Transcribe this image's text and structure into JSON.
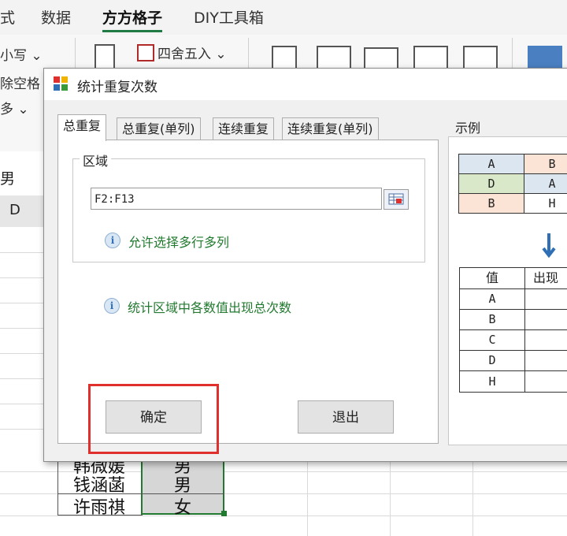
{
  "ribbon": {
    "tabs": [
      "式",
      "数据",
      "方方格子",
      "DIY工具箱"
    ],
    "active_tab": "方方格子",
    "items": {
      "lowercase": "小写 ⌄",
      "round": "四舍五入 ⌄",
      "remove_spaces": "除空格",
      "more": "多 ⌄"
    }
  },
  "sheet": {
    "cell_ref": "男",
    "column_d": "D",
    "rows": [
      {
        "name": "韩微媛",
        "gender": "男"
      },
      {
        "name": "钱涵菡",
        "gender": "男"
      },
      {
        "name": "许雨祺",
        "gender": "女"
      }
    ]
  },
  "dialog": {
    "title": "统计重复次数",
    "tabs": [
      "总重复",
      "总重复(单列)",
      "连续重复",
      "连续重复(单列)"
    ],
    "active_tab": "总重复",
    "group_label": "区域",
    "range_value": "F2:F13",
    "hint_multi": "允许选择多行多列",
    "hint_desc": "统计区域中各数值出现总次数",
    "ok_label": "确定",
    "exit_label": "退出",
    "example_label": "示例",
    "example_top": [
      [
        "A",
        "B"
      ],
      [
        "D",
        "A"
      ],
      [
        "B",
        "H"
      ]
    ],
    "example_header": [
      "值",
      "出现"
    ],
    "example_values": [
      "A",
      "B",
      "C",
      "D",
      "H"
    ]
  },
  "colors": {
    "accent": "#1f7a44",
    "highlight": "#e0302e",
    "hint_text": "#217a2f",
    "ex_blue": "#dce6f1",
    "ex_orange": "#fbe3d5",
    "ex_green": "#d8e8c8"
  }
}
